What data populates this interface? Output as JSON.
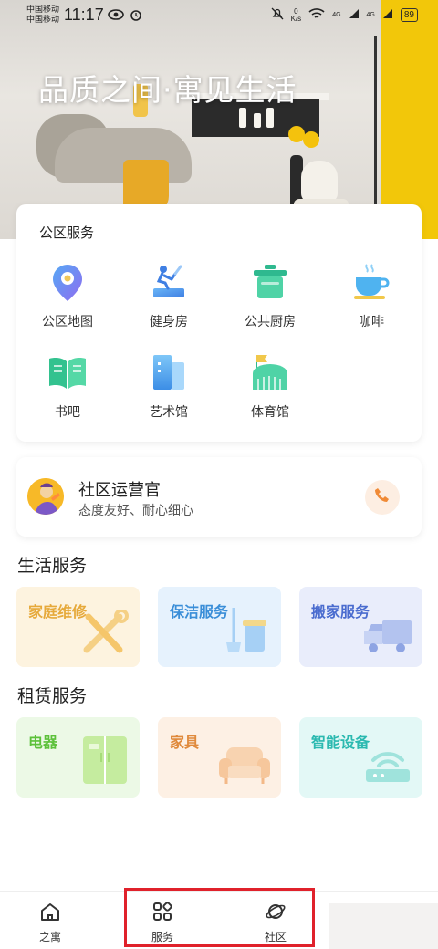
{
  "status_bar": {
    "carrier_1": "中国移动",
    "carrier_2": "中国移动",
    "time": "11:17",
    "net_speed_value": "0",
    "net_speed_unit": "K/s",
    "signal_1": "4G",
    "signal_2": "4G",
    "battery": "89"
  },
  "hero": {
    "title": "品质之间·寓见生活"
  },
  "public_services": {
    "title": "公区服务",
    "items": [
      {
        "label": "公区地图",
        "icon": "map-pin-icon"
      },
      {
        "label": "健身房",
        "icon": "treadmill-icon"
      },
      {
        "label": "公共厨房",
        "icon": "cooking-pot-icon"
      },
      {
        "label": "咖啡",
        "icon": "coffee-cup-icon"
      },
      {
        "label": "书吧",
        "icon": "open-book-icon"
      },
      {
        "label": "艺术馆",
        "icon": "gallery-building-icon"
      },
      {
        "label": "体育馆",
        "icon": "stadium-icon"
      }
    ]
  },
  "operator": {
    "name": "社区运营官",
    "subtitle": "态度友好、耐心细心",
    "phone_icon": "phone-icon"
  },
  "life_services": {
    "title": "生活服务",
    "tiles": [
      {
        "label": "家庭维修",
        "color": "#e6a93a",
        "bg": "#fdf3df"
      },
      {
        "label": "保洁服务",
        "color": "#3a8ed8",
        "bg": "#e6f2fd"
      },
      {
        "label": "搬家服务",
        "color": "#4a6ccf",
        "bg": "#e9edfb"
      }
    ]
  },
  "rental_services": {
    "title": "租赁服务",
    "tiles": [
      {
        "label": "电器",
        "color": "#5cc13a",
        "bg": "#ecf9e6"
      },
      {
        "label": "家具",
        "color": "#e08a3c",
        "bg": "#fdf0e4"
      },
      {
        "label": "智能设备",
        "color": "#2bb9b0",
        "bg": "#e3f8f6"
      }
    ]
  },
  "bottom_nav": {
    "items": [
      {
        "label": "之寓",
        "icon": "home-icon"
      },
      {
        "label": "服务",
        "icon": "grid-icon"
      },
      {
        "label": "社区",
        "icon": "planet-icon"
      }
    ]
  }
}
